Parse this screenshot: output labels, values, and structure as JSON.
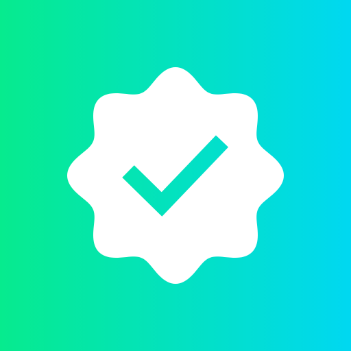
{
  "icon": {
    "name": "verified-badge-icon",
    "background": {
      "gradient_start": "#06EB8E",
      "gradient_end": "#00D8F1"
    },
    "badge_color": "#FFFFFF",
    "checkmark_color": "gradient"
  }
}
